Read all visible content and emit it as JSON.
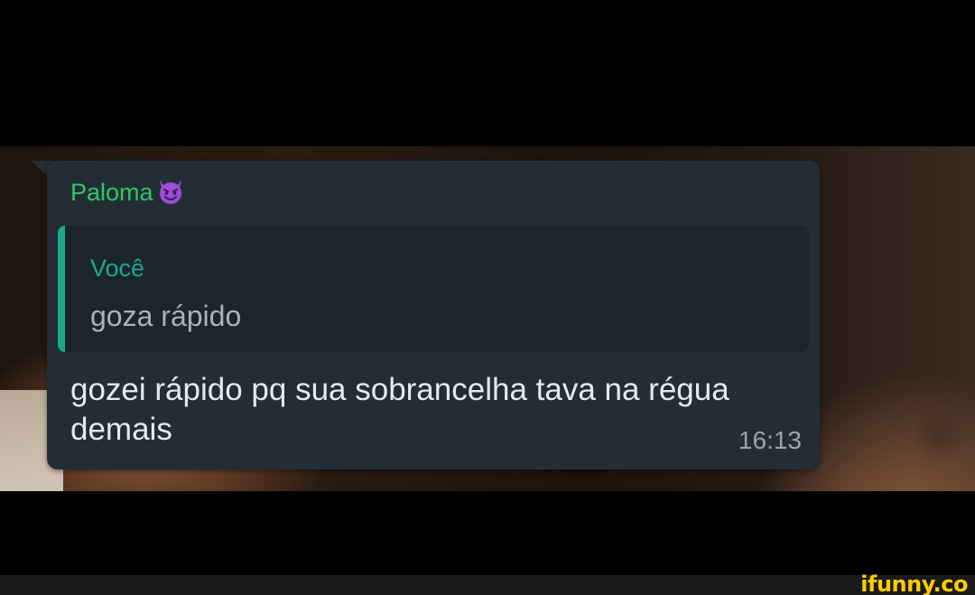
{
  "chat": {
    "sender_name": "Paloma",
    "sender_emoji": "smiling-face-with-horns",
    "quote": {
      "author": "Você",
      "text": "goza rápido"
    },
    "message": "gozei rápido pq sua sobrancelha tava na régua demais",
    "time": "16:13"
  },
  "watermark": {
    "text": "ifunny.co"
  },
  "colors": {
    "bubble": "#232d36",
    "quote_background": "#1c252d",
    "quote_accent": "#1aa889",
    "sender_name": "#2fc862",
    "message_text": "#e6e9eb",
    "timestamp": "#9aa4ab",
    "watermark": "#ffcc00"
  },
  "icons": {
    "sender_emoji": "devil-icon"
  }
}
